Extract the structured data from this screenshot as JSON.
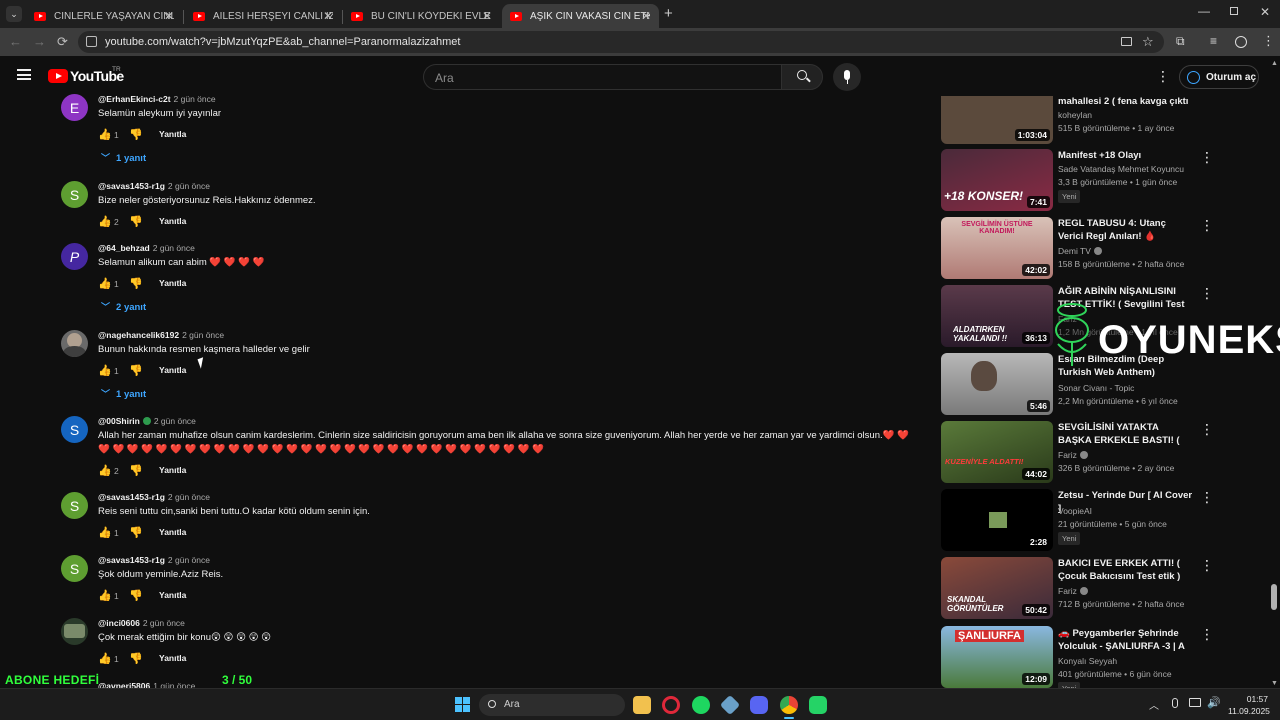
{
  "browser": {
    "tabs": [
      {
        "label": "CİNLERLE YAŞAYAN CİNLİ KADIN"
      },
      {
        "label": "AİLESİ HERŞEYİ CANLI İZLEDİ! (M"
      },
      {
        "label": "BU CİN'Lİ KÖYDEKİ EVLERİ CİNL"
      },
      {
        "label": "AŞIK CİN VAKASI CİN ETKİSİ ALTI"
      }
    ],
    "url": "youtube.com/watch?v=jbMzutYqzPE&ab_channel=Paranormalazizahmet"
  },
  "header": {
    "logo_text": "YouTube",
    "logo_country": "TR",
    "search_placeholder": "Ara",
    "signin_label": "Oturum aç"
  },
  "comments": [
    {
      "author": "@ErhanEkinci-c2t",
      "time": "2 gün önce",
      "text": "Selamün aleykum  iyi yayınlar",
      "likes": "1",
      "reply_label": "Yanıtla",
      "replies": "1 yanıt",
      "avatar_letter": "E",
      "avatar_color": "#8e35c4"
    },
    {
      "author": "@savas1453-r1g",
      "time": "2 gün önce",
      "text": "Bize neler gösteriyorsunuz Reis.Hakkınız ödenmez.",
      "likes": "2",
      "reply_label": "Yanıtla",
      "avatar_letter": "S",
      "avatar_color": "#5e9e31"
    },
    {
      "author": "@64_behzad",
      "time": "2 gün önce",
      "text": "Selamun alikum can abim ❤️ ❤️ ❤️ ❤️",
      "likes": "1",
      "reply_label": "Yanıtla",
      "replies": "2 yanıt",
      "avatar_letter": "P",
      "avatar_color": "#4527a0"
    },
    {
      "author": "@nagehancelik6192",
      "time": "2 gün önce",
      "text": "Bunun hakkında resmen kaşmera halleder ve gelir",
      "likes": "1",
      "reply_label": "Yanıtla",
      "replies": "1 yanıt",
      "avatar_letter": "",
      "avatar_color": "#5a5a5a"
    },
    {
      "author": "@00Shirin",
      "time": "2 gün önce",
      "text": "Allah her zaman muhafize olsun canim kardeslerim. Cinlerin size saldiricisin goruyorum ama ben ilk allaha ve sonra size guveniyorum. Allah her yerde ve her zaman yar ve yardimci olsun.❤️ ❤️ ❤️ ❤️ ❤️ ❤️ ❤️ ❤️ ❤️ ❤️ ❤️ ❤️ ❤️ ❤️ ❤️ ❤️ ❤️ ❤️ ❤️ ❤️ ❤️ ❤️ ❤️ ❤️ ❤️ ❤️ ❤️ ❤️ ❤️ ❤️ ❤️ ❤️ ❤️",
      "likes": "2",
      "reply_label": "Yanıtla",
      "avatar_letter": "S",
      "avatar_color": "#1565c0",
      "verified": true
    },
    {
      "author": "@savas1453-r1g",
      "time": "2 gün önce",
      "text": "Reis seni tuttu cin,sanki beni tuttu.O kadar kötü oldum senin için.",
      "likes": "1",
      "reply_label": "Yanıtla",
      "avatar_letter": "S",
      "avatar_color": "#5e9e31"
    },
    {
      "author": "@savas1453-r1g",
      "time": "2 gün önce",
      "text": "Şok oldum yeminle.Aziz Reis.",
      "likes": "1",
      "reply_label": "Yanıtla",
      "avatar_letter": "S",
      "avatar_color": "#5e9e31"
    },
    {
      "author": "@inci0606",
      "time": "2 gün önce",
      "text": "Çok merak ettiğim bir konu😲 😲 😲 😲 😲",
      "likes": "1",
      "reply_label": "Yanıtla",
      "avatar_letter": "",
      "avatar_color": "#3a4a3a"
    },
    {
      "author": "@avneri5806",
      "time": "1 gün önce",
      "text": "",
      "avatar_letter": "",
      "avatar_color": "#444"
    }
  ],
  "sidebar": [
    {
      "title": "mahallesi 2 ( fena kavga çıktı ...",
      "channel": "koheylan",
      "meta": "515 B görüntüleme • 1 ay önce",
      "duration": "1:03:04",
      "thumb_color": "#5b4a3c"
    },
    {
      "title": "Manifest +18 Olayı",
      "channel": "Sade Vatandaş Mehmet Koyuncu",
      "meta": "3,3 B görüntüleme • 1 gün önce",
      "badge": "Yeni",
      "duration": "7:41",
      "thumb_color": "#7a2a44",
      "thumb_text": "+18 KONSER!"
    },
    {
      "title": "REGL TABUSU 4: Utanç Verici Regl Anıları! 🩸 (SİZDEN ...",
      "channel": "Demi TV",
      "verified": true,
      "meta": "158 B görüntüleme • 2 hafta önce",
      "duration": "42:02",
      "thumb_color": "#c9a7a0",
      "thumb_text": "SEVGİLİMİN ÜSTÜNE KANADIM!"
    },
    {
      "title": "AĞIR ABİNİN NİŞANLISINI TEST ETTİK! ( Sevgilini Test Et Bölü...",
      "channel": "Fariz",
      "meta": "1,2 Mn görüntüleme • 1 yıl önce",
      "duration": "36:13",
      "thumb_color": "#3a2230",
      "thumb_text": "ALDATIRKEN YAKALANDI !!"
    },
    {
      "title": "Esrarı Bilmezdim (Deep Turkish Web Anthem)",
      "channel": "Sonar Civanı - Topic",
      "meta": "2,2 Mn görüntüleme • 6 yıl önce",
      "duration": "5:46",
      "thumb_color": "#8a8a8a"
    },
    {
      "title": "SEVGİLİSİNİ YATAKTA BAŞKA ERKEKLE BASTI! ( Sevgilini Te...",
      "channel": "Fariz",
      "verified": true,
      "meta": "326 B görüntüleme • 2 ay önce",
      "duration": "44:02",
      "thumb_color": "#3b5a28",
      "thumb_text": "KUZENİYLE ALDATTI!"
    },
    {
      "title": "Zetsu - Yerinde Dur [ AI Cover ]",
      "channel": "VoopieAI",
      "meta": "21 görüntüleme • 5 gün önce",
      "badge": "Yeni",
      "duration": "2:28",
      "thumb_color": "#0a0a0a"
    },
    {
      "title": "BAKICI EVE ERKEK ATTI! ( Çocuk Bakıcısını Test etik )",
      "channel": "Fariz",
      "verified": true,
      "meta": "712 B görüntüleme • 2 hafta önce",
      "duration": "50:42",
      "thumb_color": "#8a3a2a",
      "thumb_text": "SKANDAL GÖRÜNTÜLER"
    },
    {
      "title": "🚗 Peygamberler Şehrinde Yolculuk - ŞANLIURFA -3 | A ...",
      "channel": "Konyalı Seyyah",
      "meta": "401 görüntüleme • 6 gün önce",
      "badge": "Yeni",
      "duration": "12:09",
      "thumb_color": "#5a8ab8",
      "thumb_text": "ŞANLIURFA"
    }
  ],
  "overlay": {
    "goal_label": "ABONE HEDEFİ",
    "goal_count": "3   / 50",
    "goal_progress": 0.06,
    "watermark": "OYUNEKS",
    "accent": "#30ff3c"
  },
  "taskbar": {
    "search_label": "Ara",
    "time": "01:57",
    "date": "11.09.2025"
  }
}
